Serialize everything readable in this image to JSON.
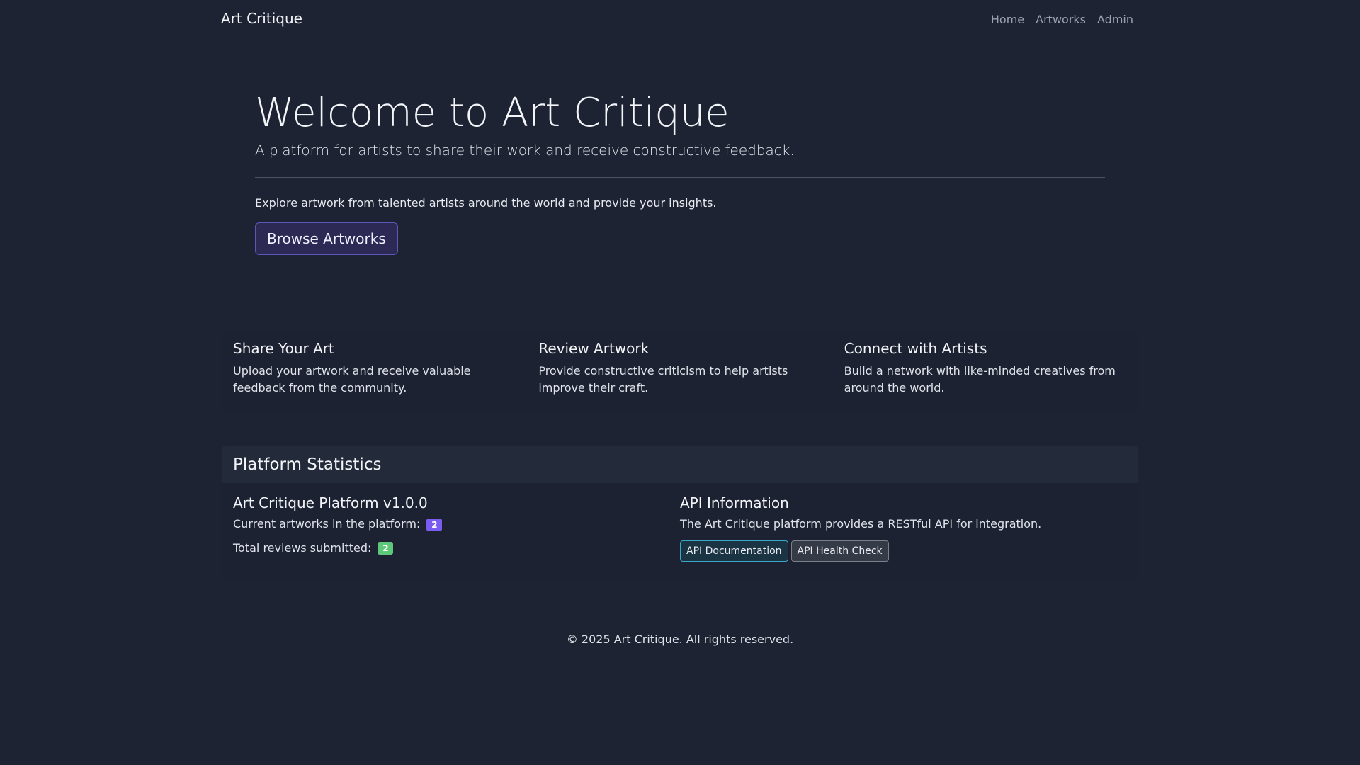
{
  "nav": {
    "brand": "Art Critique",
    "links": [
      "Home",
      "Artworks",
      "Admin"
    ]
  },
  "hero": {
    "title": "Welcome to Art Critique",
    "lead": "A platform for artists to share their work and receive constructive feedback.",
    "text": "Explore artwork from talented artists around the world and provide your insights.",
    "button": "Browse Artworks"
  },
  "features": [
    {
      "title": "Share Your Art",
      "text": "Upload your artwork and receive valuable feedback from the community."
    },
    {
      "title": "Review Artwork",
      "text": "Provide constructive criticism to help artists improve their craft."
    },
    {
      "title": "Connect with Artists",
      "text": "Build a network with like-minded creatives from around the world."
    }
  ],
  "stats": {
    "header": "Platform Statistics",
    "platform": {
      "title": "Art Critique Platform v1.0.0",
      "artworks_label": "Current artworks in the platform:",
      "artworks_count": "2",
      "reviews_label": "Total reviews submitted:",
      "reviews_count": "2"
    },
    "api": {
      "title": "API Information",
      "text": "The Art Critique platform provides a RESTful API for integration.",
      "doc_button": "API Documentation",
      "health_button": "API Health Check"
    }
  },
  "footer": {
    "text": "© 2025 Art Critique. All rights reserved."
  },
  "colors": {
    "background": "#1d2333",
    "badge_purple": "#7b5cf0",
    "badge_green": "#5fc77a",
    "primary_border": "#5b57b8",
    "info_border": "#3aa9c9"
  }
}
